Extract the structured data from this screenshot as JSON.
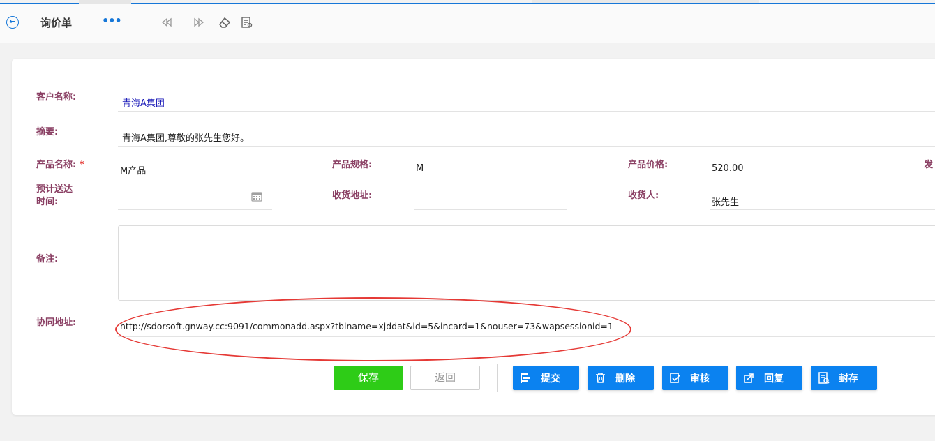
{
  "toolbar": {
    "title": "询价单",
    "more": "•••",
    "back_icon": "circle-arrow-left-icon"
  },
  "form": {
    "customer": {
      "label": "客户名称:",
      "value": "青海A集团"
    },
    "summary": {
      "label": "摘要:",
      "value": "青海A集团,尊敬的张先生您好。"
    },
    "product_name": {
      "label": "产品名称:",
      "required": "*",
      "value": "M产品"
    },
    "product_spec": {
      "label": "产品规格:",
      "value": "M"
    },
    "product_price": {
      "label": "产品价格:",
      "value": "520.00"
    },
    "partial_label": "发",
    "delivery_time": {
      "label_line1": "预计送达",
      "label_line2": "时间:",
      "value": ""
    },
    "delivery_address": {
      "label": "收货地址:",
      "value": ""
    },
    "receiver": {
      "label": "收货人:",
      "value": "张先生"
    },
    "remark": {
      "label": "备注:",
      "value": ""
    },
    "collab_url": {
      "label": "协同地址:",
      "value": "http://sdorsoft.gnway.cc:9091/commonadd.aspx?tblname=xjddat&id=5&incard=1&nouser=73&wapsessionid=1"
    }
  },
  "buttons": {
    "save": "保存",
    "back": "返回",
    "submit": "提交",
    "delete": "删除",
    "review": "审核",
    "reply": "回复",
    "archive": "封存"
  },
  "colors": {
    "accent": "#1677d8",
    "label": "#8a3f63",
    "save_green": "#2ecc17",
    "action_blue": "#0b82f0",
    "annotation_red": "#e53935"
  }
}
